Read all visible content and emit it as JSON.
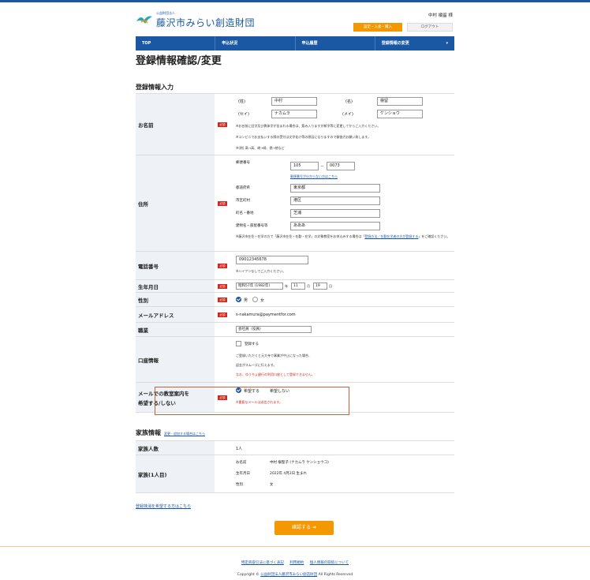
{
  "header": {
    "logo_small": "公益財団法人",
    "logo_text": "藤沢市みらい創造財団",
    "user_name": "中村 槇留 様",
    "btn_settings": "設定・入会・購入",
    "btn_logout": "ログアウト"
  },
  "nav": {
    "items": [
      "TOP",
      "申込状況",
      "申込履歴",
      "登録情報の変更"
    ],
    "caret": "▾"
  },
  "page_title": "登録情報確認/変更",
  "section_input_title": "登録情報入力",
  "required_badge": "必須",
  "name": {
    "label": "お名前",
    "sei_label": "(姓)",
    "sei_value": "中村",
    "mei_label": "(名)",
    "mei_value": "槇留",
    "sei_kana_label": "(セイ)",
    "sei_kana_value": "ナカムラ",
    "mei_kana_label": "(メイ)",
    "mei_kana_value": "ケンショウ",
    "note1": "※お名前に旧字及び異体字が含まれる場合は、筋み入りますが新字等に変更してからご入力ください。",
    "note2": "※コンビニでお支払いする際の受付は文字化け等の原因になりますので御協力お願い致します。",
    "note3": "※(例) 髙→高、﨑→崎、德→徳など"
  },
  "address": {
    "label": "住所",
    "postal_label": "郵便番号",
    "postal1": "105",
    "postal_dash": "－",
    "postal2": "0073",
    "postal_link": "郵便番号が分からない方はこちら",
    "pref_label": "都道府県",
    "pref_value": "東京都",
    "city_label": "市区町村",
    "city_value": "港区",
    "town_label": "町名・番地",
    "town_value": "芝浦",
    "building_label": "建物名・部屋番号等",
    "building_value": "あああ",
    "note_pre": "※藤沢市在住・在学の方で「藤沢市在住・在勤・在学」の対象教室をお申込みする場合は「",
    "note_link": "登録方法／在勤在学者の方が登録する",
    "note_post": "」をご確認ください。"
  },
  "phone": {
    "label": "電話番号",
    "value": "09012345678",
    "note": "※ハイフンなしでご入力ください。"
  },
  "birth": {
    "label": "生年月日",
    "year": "昭和57年 (1982年)",
    "year_unit": "年",
    "month": "11",
    "month_unit": "月",
    "day": "19",
    "day_unit": "日"
  },
  "gender": {
    "label": "性別",
    "male": "男",
    "female": "女"
  },
  "email": {
    "label": "メールアドレス",
    "value": "s-nakamura@paymentfor.com"
  },
  "job": {
    "label": "職業",
    "value": "会社員（役員）"
  },
  "bank": {
    "label": "口座情報",
    "checkbox_label": "登録する",
    "note1": "ご登録いただくと元大寺で事業が中止になった場合、",
    "note2": "返金がスムーズに行えます。",
    "note3": "なお、ゆうちょ銀行の利用口座として登録できません。"
  },
  "mail_pref": {
    "label_line1": "メールでの教室案内を",
    "label_line2": "希望する/しない",
    "yes": "希望する",
    "no": "希望しない",
    "note": "※重要なメールは送信されます。"
  },
  "family": {
    "title": "家族情報",
    "change_link": "変更・追加する場合はこちら",
    "count_label": "家族人数",
    "count_value": "1人",
    "member_label": "家族(1人目)",
    "name_label": "お名前",
    "name_value": "中村 槇聖子 (ナカムラ ケンショウコ)",
    "birth_label": "生年月日",
    "birth_value": "2022年 4月2日 生まれ",
    "gender_label": "性別",
    "gender_value": "女"
  },
  "cancel_link": "登録抹消を希望する方はこちら",
  "confirm_button": "確認する",
  "confirm_icon": "➔",
  "footer": {
    "links": [
      "特定商取引法に基づく表記",
      "利用規約",
      "個人情報の取扱について"
    ],
    "copyright_pre": "Copyright ©",
    "copyright_org": "公益財団法人藤沢市みらい創造財団",
    "copyright_post": "All Rights Reserved"
  },
  "colors": {
    "brand_blue": "#1b58a3",
    "accent_orange": "#f39800",
    "required_red": "#d7261b"
  }
}
